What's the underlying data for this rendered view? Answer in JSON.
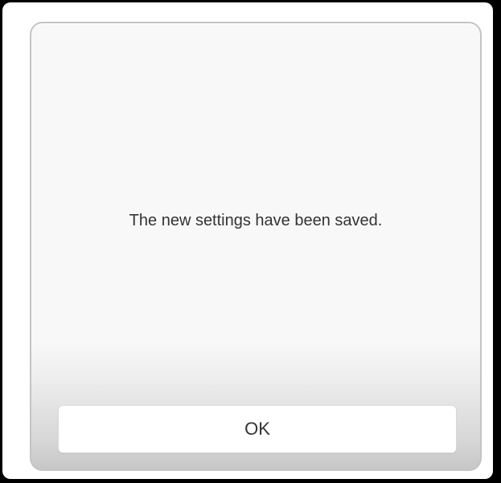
{
  "dialog": {
    "message": "The new settings have been saved.",
    "ok_label": "OK"
  }
}
